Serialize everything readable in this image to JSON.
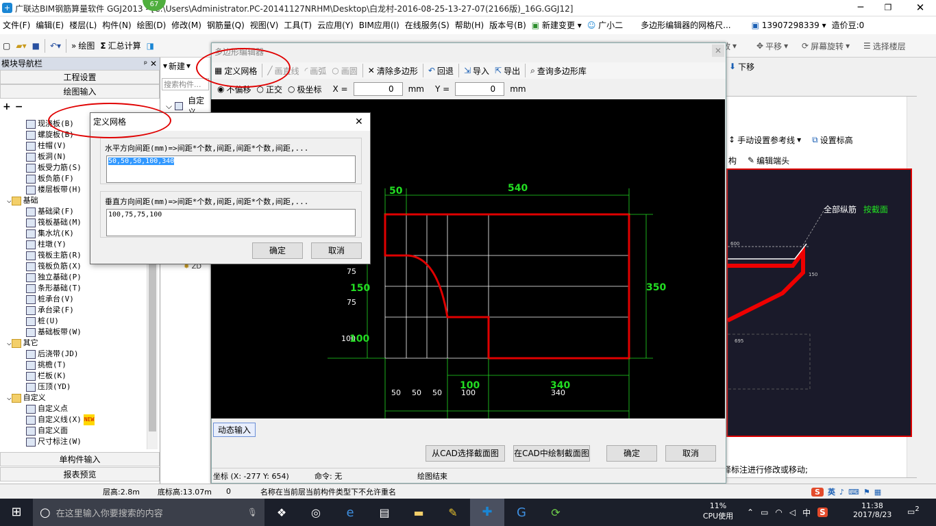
{
  "title_bar": {
    "text": "广联达BIM钢筋算量软件 GGJ2013 - [C:\\Users\\Administrator.PC-20141127NRHM\\Desktop\\白龙村-2016-08-25-13-27-07(2166版)_16G.GGJ12]",
    "badge": "67"
  },
  "menu": [
    "文件(F)",
    "编辑(E)",
    "楼层(L)",
    "构件(N)",
    "绘图(D)",
    "修改(M)",
    "钢筋量(Q)",
    "视图(V)",
    "工具(T)",
    "云应用(Y)",
    "BIM应用(I)",
    "在线服务(S)",
    "帮助(H)",
    "版本号(B)",
    "新建变更",
    "广小二",
    "多边形编辑器的网格尺...",
    "13907298339",
    "造价豆:0"
  ],
  "toolbar": {
    "draw": "绘图",
    "sum_calc": "汇总计算",
    "zoom": "缩放",
    "pan": "平移",
    "rotate": "屏幕旋转",
    "select_floor": "选择楼层",
    "move_down": "下移",
    "manual_ref": "手动设置参考线",
    "set_elev": "设置标高",
    "struct": "构",
    "edit_end": "编辑端头"
  },
  "left_panel": {
    "title": "模块导航栏",
    "section_project": "工程设置",
    "section_draw": "绘图输入",
    "section_single": "单构件输入",
    "section_report": "报表预览",
    "tree": [
      {
        "label": "现浇板(B)",
        "indent": 2
      },
      {
        "label": "螺旋板(B)",
        "indent": 2
      },
      {
        "label": "柱帽(V)",
        "indent": 2
      },
      {
        "label": "板洞(N)",
        "indent": 2
      },
      {
        "label": "板受力筋(S)",
        "indent": 2
      },
      {
        "label": "板负筋(F)",
        "indent": 2
      },
      {
        "label": "楼层板带(H)",
        "indent": 2
      },
      {
        "label": "基础",
        "indent": 1,
        "folder": true
      },
      {
        "label": "基础梁(F)",
        "indent": 2
      },
      {
        "label": "筏板基础(M)",
        "indent": 2
      },
      {
        "label": "集水坑(K)",
        "indent": 2
      },
      {
        "label": "柱墩(Y)",
        "indent": 2
      },
      {
        "label": "筏板主筋(R)",
        "indent": 2
      },
      {
        "label": "筏板负筋(X)",
        "indent": 2
      },
      {
        "label": "独立基础(P)",
        "indent": 2
      },
      {
        "label": "条形基础(T)",
        "indent": 2
      },
      {
        "label": "桩承台(V)",
        "indent": 2
      },
      {
        "label": "承台梁(F)",
        "indent": 2
      },
      {
        "label": "桩(U)",
        "indent": 2
      },
      {
        "label": "基础板带(W)",
        "indent": 2
      },
      {
        "label": "其它",
        "indent": 1,
        "folder": true
      },
      {
        "label": "后浇带(JD)",
        "indent": 2
      },
      {
        "label": "挑檐(T)",
        "indent": 2
      },
      {
        "label": "栏板(K)",
        "indent": 2
      },
      {
        "label": "压顶(YD)",
        "indent": 2
      },
      {
        "label": "自定义",
        "indent": 1,
        "folder": true
      },
      {
        "label": "自定义点",
        "indent": 2
      },
      {
        "label": "自定义线(X)",
        "indent": 2,
        "badge": "NEW"
      },
      {
        "label": "自定义面",
        "indent": 2
      },
      {
        "label": "尺寸标注(W)",
        "indent": 2
      }
    ]
  },
  "mid_panel": {
    "new": "新建",
    "search_placeholder": "搜索构件...",
    "item": "自定义",
    "item2": "ZD"
  },
  "editor": {
    "title": "多边形编辑器",
    "tools": {
      "define_grid": "定义网格",
      "line": "画直线",
      "arc": "画弧",
      "circle": "画圆",
      "clear": "清除多边形",
      "undo": "回退",
      "import": "导入",
      "export": "导出",
      "query": "查询多边形库"
    },
    "modes": {
      "none": "不偏移",
      "ortho": "正交",
      "polar": "极坐标"
    },
    "x_label": "X =",
    "x_value": "0",
    "y_label": "Y =",
    "y_value": "0",
    "unit": "mm",
    "dynamic_input": "动态输入",
    "btn_cad_select": "从CAD选择截面图",
    "btn_cad_draw": "在CAD中绘制截面图",
    "btn_ok": "确定",
    "btn_cancel": "取消",
    "status_coord": "坐标 (X: -277 Y: 654)",
    "status_cmd": "命令: 无",
    "status_end": "绘图结束"
  },
  "canvas_dims": {
    "top_left": "50",
    "top_right": "540",
    "right": "350",
    "left_a": "75",
    "left_b": "150",
    "left_c": "75",
    "left_d": "100",
    "left_d2": "100",
    "bot_a": "50",
    "bot_b": "50",
    "bot_c": "50",
    "bot_d": "100",
    "bot_e": "340",
    "bot_f": "100",
    "bot_g": "340"
  },
  "dialog": {
    "title": "定义网格",
    "h_label": "水平方向间距(mm)=>间距*个数,间距,间距*个数,间距,...",
    "h_value": "50,50,50,100,340",
    "v_label": "垂直方向间距(mm)=>间距*个数,间距,间距*个数,间距,...",
    "v_value": "100,75,75,100",
    "ok": "确定",
    "cancel": "取消"
  },
  "right_panel": {
    "label1": "全部纵筋",
    "label2": "按截面",
    "dim600": "600",
    "dim150": "150",
    "dim695": "695",
    "note": "择标注进行修改或移动;"
  },
  "status": {
    "floor_h": "层高:2.8m",
    "bottom_h": "底标高:13.07m",
    "zero": "0",
    "msg": "名称在当前层当前构件类型下不允许重名"
  },
  "taskbar": {
    "search": "在这里输入你要搜索的内容",
    "cpu": "11%",
    "cpu_label": "CPU使用",
    "ime": "中",
    "time": "11:38",
    "date": "2017/8/23",
    "notif": "2",
    "lang": "英"
  },
  "colors": {
    "red": "#e00000",
    "green": "#22dd22",
    "grid": "#ffffff",
    "accent": "#1a5fb4"
  }
}
